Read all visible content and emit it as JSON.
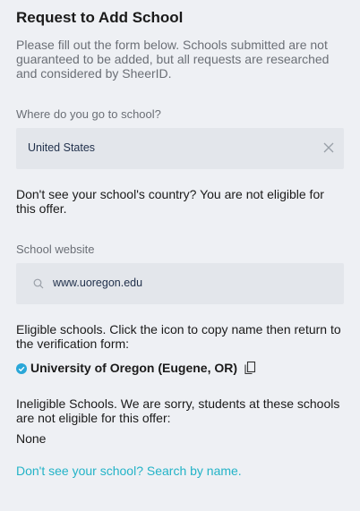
{
  "header": {
    "title": "Request to Add School",
    "intro": "Please fill out the form below. Schools submitted are not guaranteed to be added, but all requests are researched and considered by SheerID."
  },
  "country": {
    "label": "Where do you go to school?",
    "value": "United States",
    "clear_icon": "close-icon"
  },
  "country_note": "Don't see your school's country? You are not eligible for this offer.",
  "website": {
    "label": "School website",
    "value": "www.uoregon.edu",
    "search_icon": "search-icon"
  },
  "eligible": {
    "text": "Eligible schools. Click the icon to copy name then return to the verification form:",
    "schools": [
      {
        "name": "University of Oregon (Eugene, OR)",
        "status_icon": "check-circle-icon",
        "copy_icon": "copy-icon"
      }
    ]
  },
  "ineligible": {
    "text": "Ineligible Schools. We are sorry, students at these schools are not eligible for this offer:",
    "value": "None"
  },
  "search_link": "Don't see your school? Search by name.",
  "colors": {
    "background": "#eef0f4",
    "field": "#e3e6eb",
    "link": "#23b3c7",
    "check": "#2aa7d8",
    "muted_text": "#6b6f76"
  }
}
